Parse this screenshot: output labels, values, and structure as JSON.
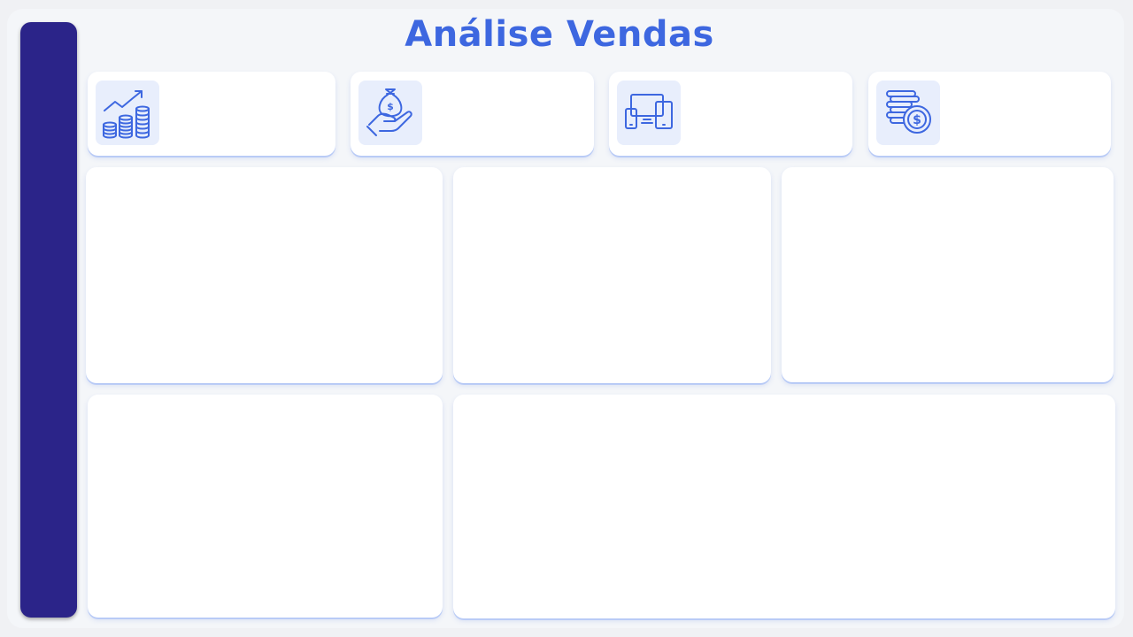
{
  "header": {
    "title": "Análise Vendas"
  },
  "colors": {
    "sidebar": "#2b2489",
    "title": "#3d67e0",
    "icon_stroke": "#3d67e0",
    "icon_tile": "#e8eefc",
    "card_background": "#ffffff",
    "page_background": "#f4f6f9"
  },
  "kpi_cards": [
    {
      "icon": "growth-coins-icon"
    },
    {
      "icon": "hand-money-bag-icon"
    },
    {
      "icon": "devices-icon"
    },
    {
      "icon": "coin-stack-dollar-icon"
    }
  ],
  "chart_panels": [
    {
      "id": "panel-1"
    },
    {
      "id": "panel-2"
    },
    {
      "id": "panel-3"
    },
    {
      "id": "panel-4"
    },
    {
      "id": "panel-5"
    }
  ]
}
